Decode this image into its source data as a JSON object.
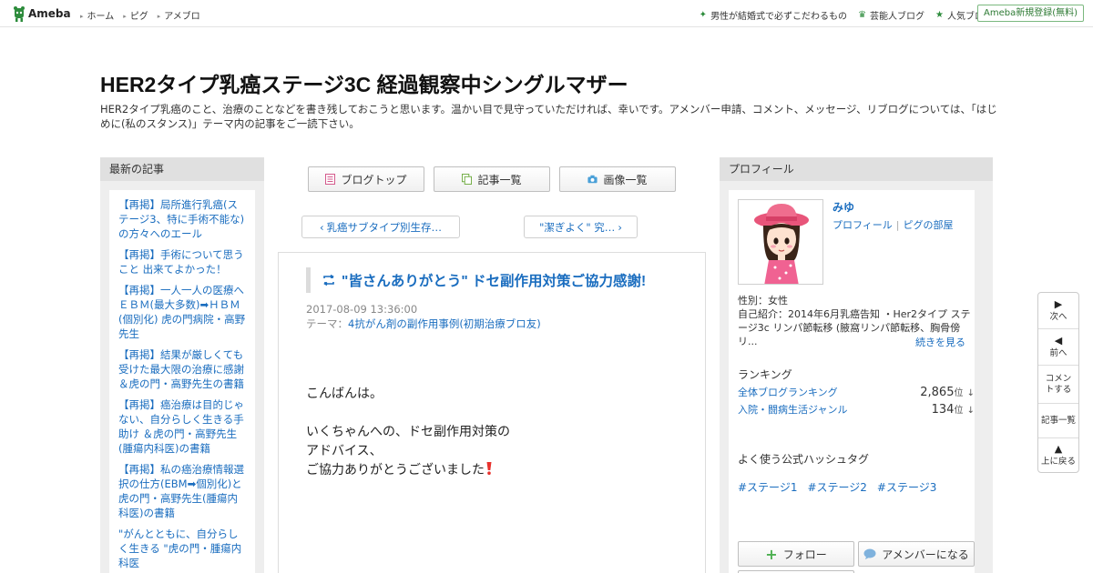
{
  "topbar": {
    "logo_text": "Ameba",
    "nav": [
      "ホーム",
      "ピグ",
      "アメブロ"
    ],
    "right_links": [
      {
        "label": "男性が結婚式で必ずこだわるもの",
        "icon": "sparkle-icon"
      },
      {
        "label": "芸能人ブログ",
        "icon": "crown-icon"
      },
      {
        "label": "人気ブログ",
        "icon": "star-icon"
      }
    ],
    "signup_label": "Ameba新規登録(無料)"
  },
  "header": {
    "title": "HER2タイプ乳癌ステージ3C 経過観察中シングルマザー",
    "description": "HER2タイプ乳癌のこと、治療のことなどを書き残しておこうと思います。温かい目で見守っていただければ、幸いです。アメンバー申請、コメント、メッセージ、リブログについては、「はじめに(私のスタンス)」テーマ内の記事をご一読下さい。"
  },
  "left": {
    "heading": "最新の記事",
    "articles": [
      "【再掲】局所進行乳癌(ステージ3、特に手術不能な)の方々へのエール",
      "【再掲】手術について思うこと 出来てよかった！",
      "【再掲】一人一人の医療へ ＥＢＭ(最大多数)➡ＨＢＭ(個別化) 虎の門病院・高野先生",
      "【再掲】結果が厳しくても受けた最大限の治療に感謝 ＆虎の門・高野先生の書籍",
      "【再掲】癌治療は目的じゃない、自分らしく生きる手助け ＆虎の門・高野先生(腫瘍内科医)の書籍",
      "【再掲】私の癌治療情報選択の仕方(EBM➡個別化)と虎の門・高野先生(腫瘍内科医)の書籍",
      "\"がんとともに、自分らしく生きる \"虎の門・腫瘍内科医"
    ]
  },
  "center": {
    "tabs": [
      {
        "label": "ブログトップ",
        "icon": "document-icon",
        "color": "#d45a8c"
      },
      {
        "label": "記事一覧",
        "icon": "copy-icon",
        "color": "#6aa83a"
      },
      {
        "label": "画像一覧",
        "icon": "camera-icon",
        "color": "#4aa0d8"
      }
    ],
    "prev_label": "乳癌サブタイプ別生存…",
    "next_label": "\"潔ぎよく\" 究…",
    "article": {
      "title": "\"皆さんありがとう\" ドセ副作用対策ご協力感謝!",
      "date": "2017-08-09 13:36:00",
      "theme_prefix": "テーマ：",
      "theme": "4抗がん剤の副作用事例(初期治療ブロ友)",
      "body": [
        "こんばんは。",
        "",
        "いくちゃんへの、ドセ副作用対策の",
        "アドバイス、",
        "ご協力ありがとうございました"
      ]
    }
  },
  "right": {
    "heading": "プロフィール",
    "name": "みゆ",
    "link_profile": "プロフィール",
    "link_room": "ピグの部屋",
    "gender": "性別：女性",
    "intro": "自己紹介：2014年6月乳癌告知 ・Her2タイプ ステージ3c リンパ節転移 (腋窩リンパ節転移、胸骨傍リ...",
    "more": "続きを見る",
    "ranking_heading": "ランキング",
    "rankings": [
      {
        "label": "全体ブログランキング",
        "value": "2,865",
        "unit": "位",
        "arrow": "↓"
      },
      {
        "label": "入院・闘病生活ジャンル",
        "value": "134",
        "unit": "位",
        "arrow": "↓"
      }
    ],
    "hashtag_heading": "よく使う公式ハッシュタグ",
    "hashtags": [
      "#ステージ1",
      "#ステージ2",
      "#ステージ3"
    ],
    "follow_label": "フォロー",
    "amember_label": "アメンバーになる"
  },
  "sidenav": {
    "next": "次へ",
    "prev": "前へ",
    "comment": "コメントする",
    "list": "記事一覧",
    "top": "上に戻る"
  }
}
